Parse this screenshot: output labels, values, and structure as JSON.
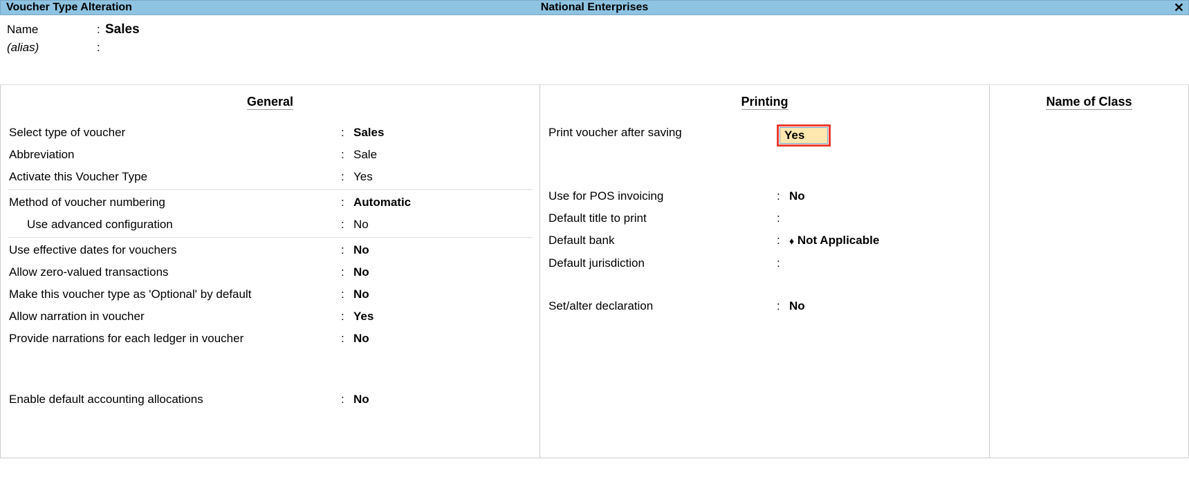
{
  "titlebar": {
    "left": "Voucher Type Alteration",
    "center": "National Enterprises",
    "close": "✕"
  },
  "header": {
    "name_label": "Name",
    "name_value": "Sales",
    "alias_label": "(alias)"
  },
  "sections": {
    "general_title": "General",
    "printing_title": "Printing",
    "class_title": "Name of Class"
  },
  "general": {
    "select_type_label": "Select type of voucher",
    "select_type_value": "Sales",
    "abbrev_label": "Abbreviation",
    "abbrev_value": "Sale",
    "activate_label": "Activate this Voucher Type",
    "activate_value": "Yes",
    "numbering_label": "Method of voucher numbering",
    "numbering_value": "Automatic",
    "advconfig_label": "Use advanced configuration",
    "advconfig_value": "No",
    "effdates_label": "Use effective dates for vouchers",
    "effdates_value": "No",
    "zero_label": "Allow zero-valued transactions",
    "zero_value": "No",
    "optional_label": "Make this voucher type as 'Optional' by default",
    "optional_value": "No",
    "narration_label": "Allow narration in voucher",
    "narration_value": "Yes",
    "ledger_narr_label": "Provide narrations for each ledger in voucher",
    "ledger_narr_value": "No",
    "alloc_label": "Enable default accounting allocations",
    "alloc_value": "No"
  },
  "printing": {
    "print_after_label": "Print voucher after saving",
    "print_after_value": "Yes",
    "pos_label": "Use for POS invoicing",
    "pos_value": "No",
    "title_label": "Default title to print",
    "title_value": "",
    "bank_label": "Default bank",
    "bank_value": "Not Applicable",
    "bank_symbol": "♦",
    "jurisdiction_label": "Default jurisdiction",
    "jurisdiction_value": "",
    "declaration_label": "Set/alter declaration",
    "declaration_value": "No"
  }
}
